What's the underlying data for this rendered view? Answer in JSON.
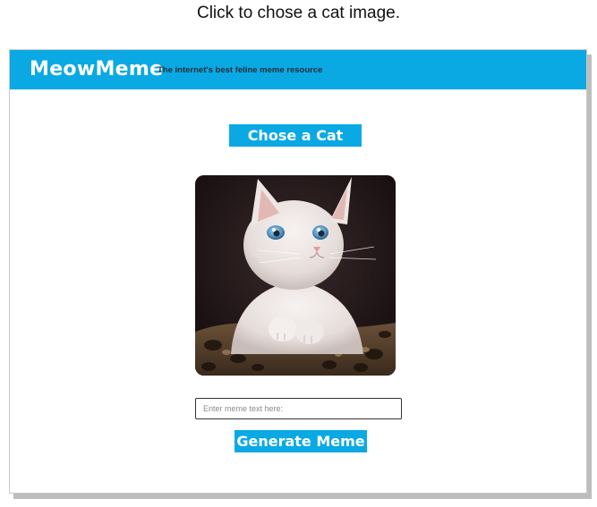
{
  "instruction": "Click to chose a cat image.",
  "header": {
    "brand": "MeowMeme",
    "tagline": "The internet's best feline meme resource",
    "color": "#0aa9e3"
  },
  "choose_button": {
    "label": "Chose a Cat"
  },
  "cat_image": {
    "subject": "white kitten with blue eyes on a leopard-print cushion"
  },
  "meme_input": {
    "value": "",
    "placeholder": "Enter meme text here:"
  },
  "generate_button": {
    "label": "Generate Meme"
  }
}
